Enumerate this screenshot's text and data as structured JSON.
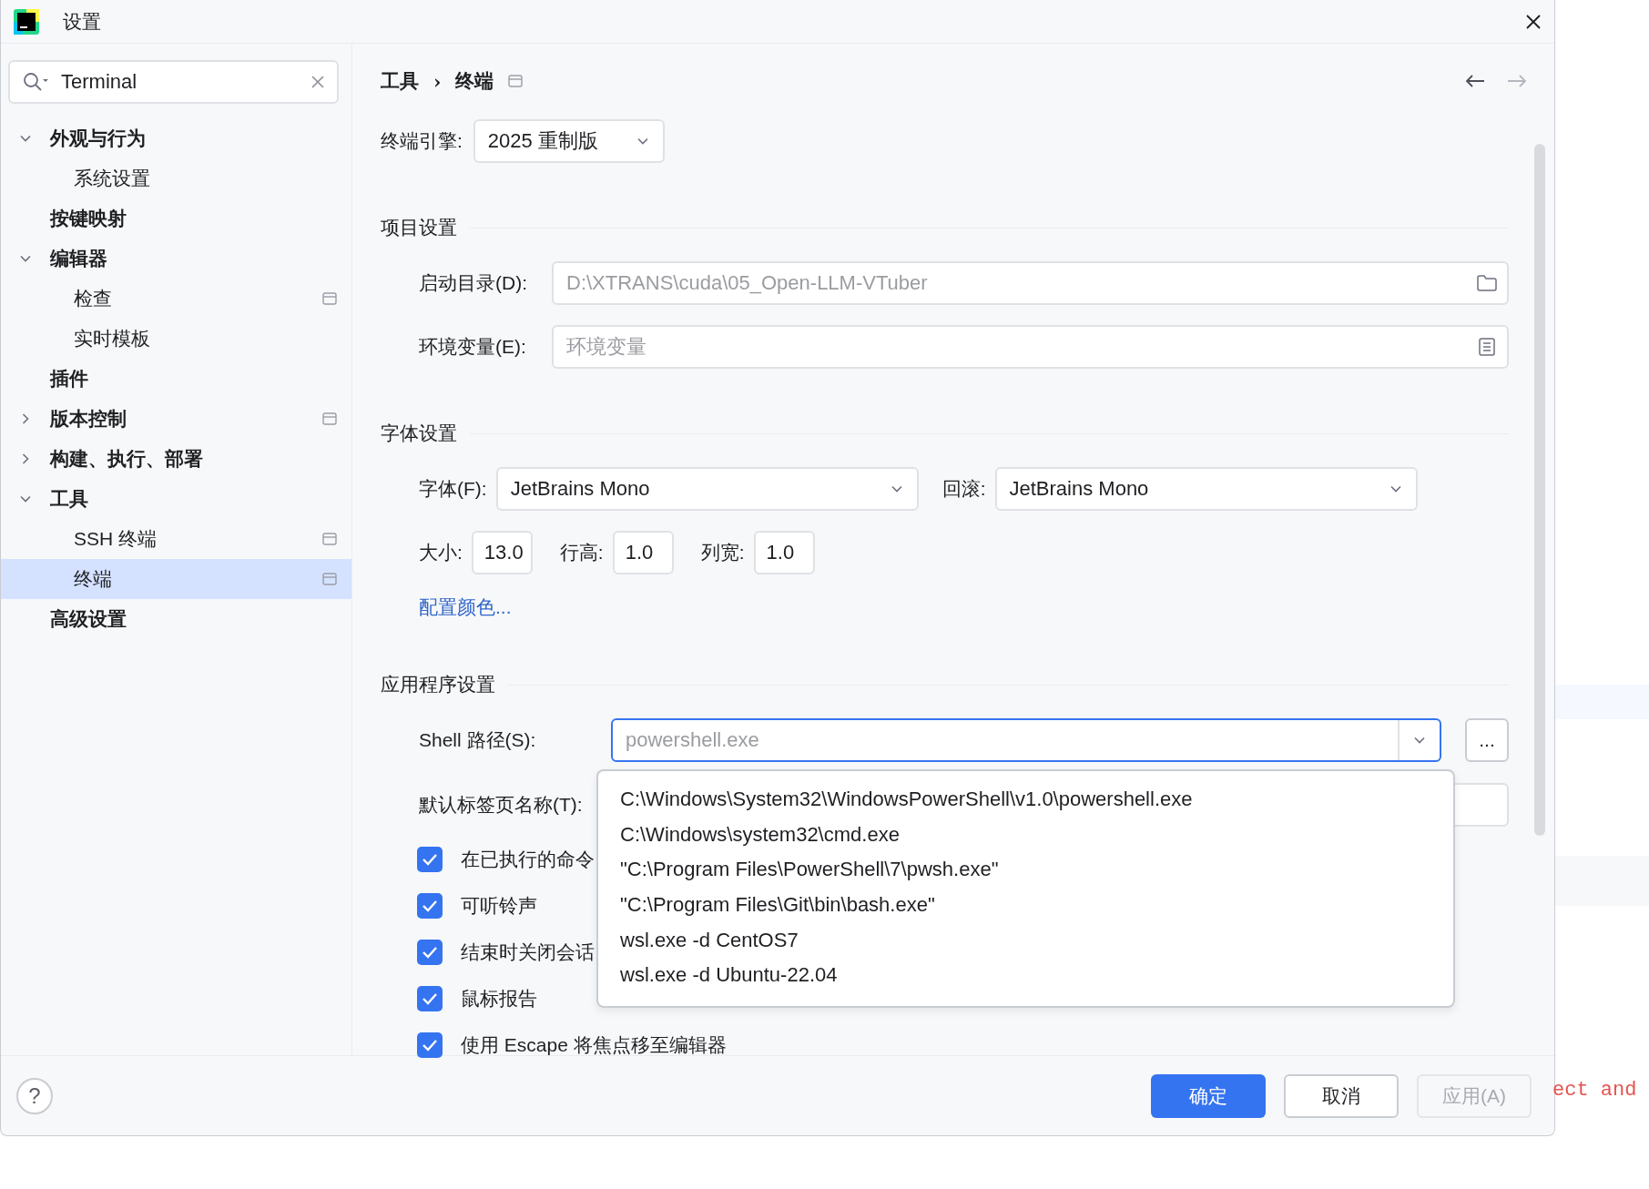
{
  "window": {
    "title": "设置"
  },
  "search": {
    "value": "Terminal"
  },
  "sidebar": {
    "items": [
      {
        "label": "外观与行为",
        "kind": "folder",
        "expanded": true,
        "selected": false,
        "scoped": false,
        "children": [
          {
            "label": "系统设置",
            "selected": false,
            "scoped": false
          }
        ]
      },
      {
        "label": "按键映射",
        "kind": "leaf",
        "selected": false,
        "scoped": false
      },
      {
        "label": "编辑器",
        "kind": "folder",
        "expanded": true,
        "selected": false,
        "scoped": false,
        "children": [
          {
            "label": "检查",
            "selected": false,
            "scoped": true
          },
          {
            "label": "实时模板",
            "selected": false,
            "scoped": false
          }
        ]
      },
      {
        "label": "插件",
        "kind": "leaf",
        "selected": false,
        "scoped": false
      },
      {
        "label": "版本控制",
        "kind": "folder",
        "expanded": false,
        "selected": false,
        "scoped": true
      },
      {
        "label": "构建、执行、部署",
        "kind": "folder",
        "expanded": false,
        "selected": false,
        "scoped": false
      },
      {
        "label": "工具",
        "kind": "folder",
        "expanded": true,
        "selected": false,
        "scoped": false,
        "children": [
          {
            "label": "SSH 终端",
            "selected": false,
            "scoped": true
          },
          {
            "label": "终端",
            "selected": true,
            "scoped": true
          }
        ]
      },
      {
        "label": "高级设置",
        "kind": "leaf",
        "selected": false,
        "scoped": false
      }
    ]
  },
  "breadcrumb": [
    "工具",
    "›",
    "终端"
  ],
  "engine": {
    "label": "终端引擎:",
    "value": "2025 重制版"
  },
  "project_section": {
    "title": "项目设置",
    "fields": [
      {
        "label": "启动目录(D):",
        "placeholder": "D:\\XTRANS\\cuda\\05_Open-LLM-VTuber",
        "kind": "folder"
      },
      {
        "label": "环境变量(E):",
        "placeholder": "环境变量",
        "kind": "list"
      }
    ]
  },
  "font_section": {
    "title": "字体设置",
    "font": {
      "label": "字体(F):",
      "value": "JetBrains Mono"
    },
    "fallback": {
      "label": "回滚:",
      "value": "JetBrains Mono"
    },
    "metrics": [
      {
        "label": "大小:",
        "value": "13.0"
      },
      {
        "label": "行高:",
        "value": "1.0"
      },
      {
        "label": "列宽:",
        "value": "1.0"
      }
    ],
    "link": "配置颜色..."
  },
  "app_section": {
    "title": "应用程序设置",
    "shell": {
      "label": "Shell 路径(S):",
      "placeholder": "powershell.exe",
      "browse": "..."
    },
    "tab_name": {
      "label": "默认标签页名称(T):"
    },
    "options": [
      "C:\\Windows\\System32\\WindowsPowerShell\\v1.0\\powershell.exe",
      "C:\\Windows\\system32\\cmd.exe",
      "\"C:\\Program Files\\PowerShell\\7\\pwsh.exe\"",
      "\"C:\\Program Files\\Git\\bin\\bash.exe\"",
      "wsl.exe -d CentOS7",
      "wsl.exe -d Ubuntu-22.04"
    ],
    "checkboxes": [
      {
        "label": "在已执行的命令",
        "checked": true
      },
      {
        "label": "可听铃声",
        "checked": true
      },
      {
        "label": "结束时关闭会话",
        "checked": true
      },
      {
        "label": "鼠标报告",
        "checked": true
      },
      {
        "label": "使用 Escape 将焦点移至编辑器",
        "checked": true
      }
    ]
  },
  "footer": {
    "help": "?",
    "buttons": [
      {
        "label": "确定",
        "kind": "primary"
      },
      {
        "label": "取消",
        "kind": "normal"
      },
      {
        "label": "应用(A)",
        "kind": "disabled"
      }
    ]
  },
  "background_code": "ect and"
}
